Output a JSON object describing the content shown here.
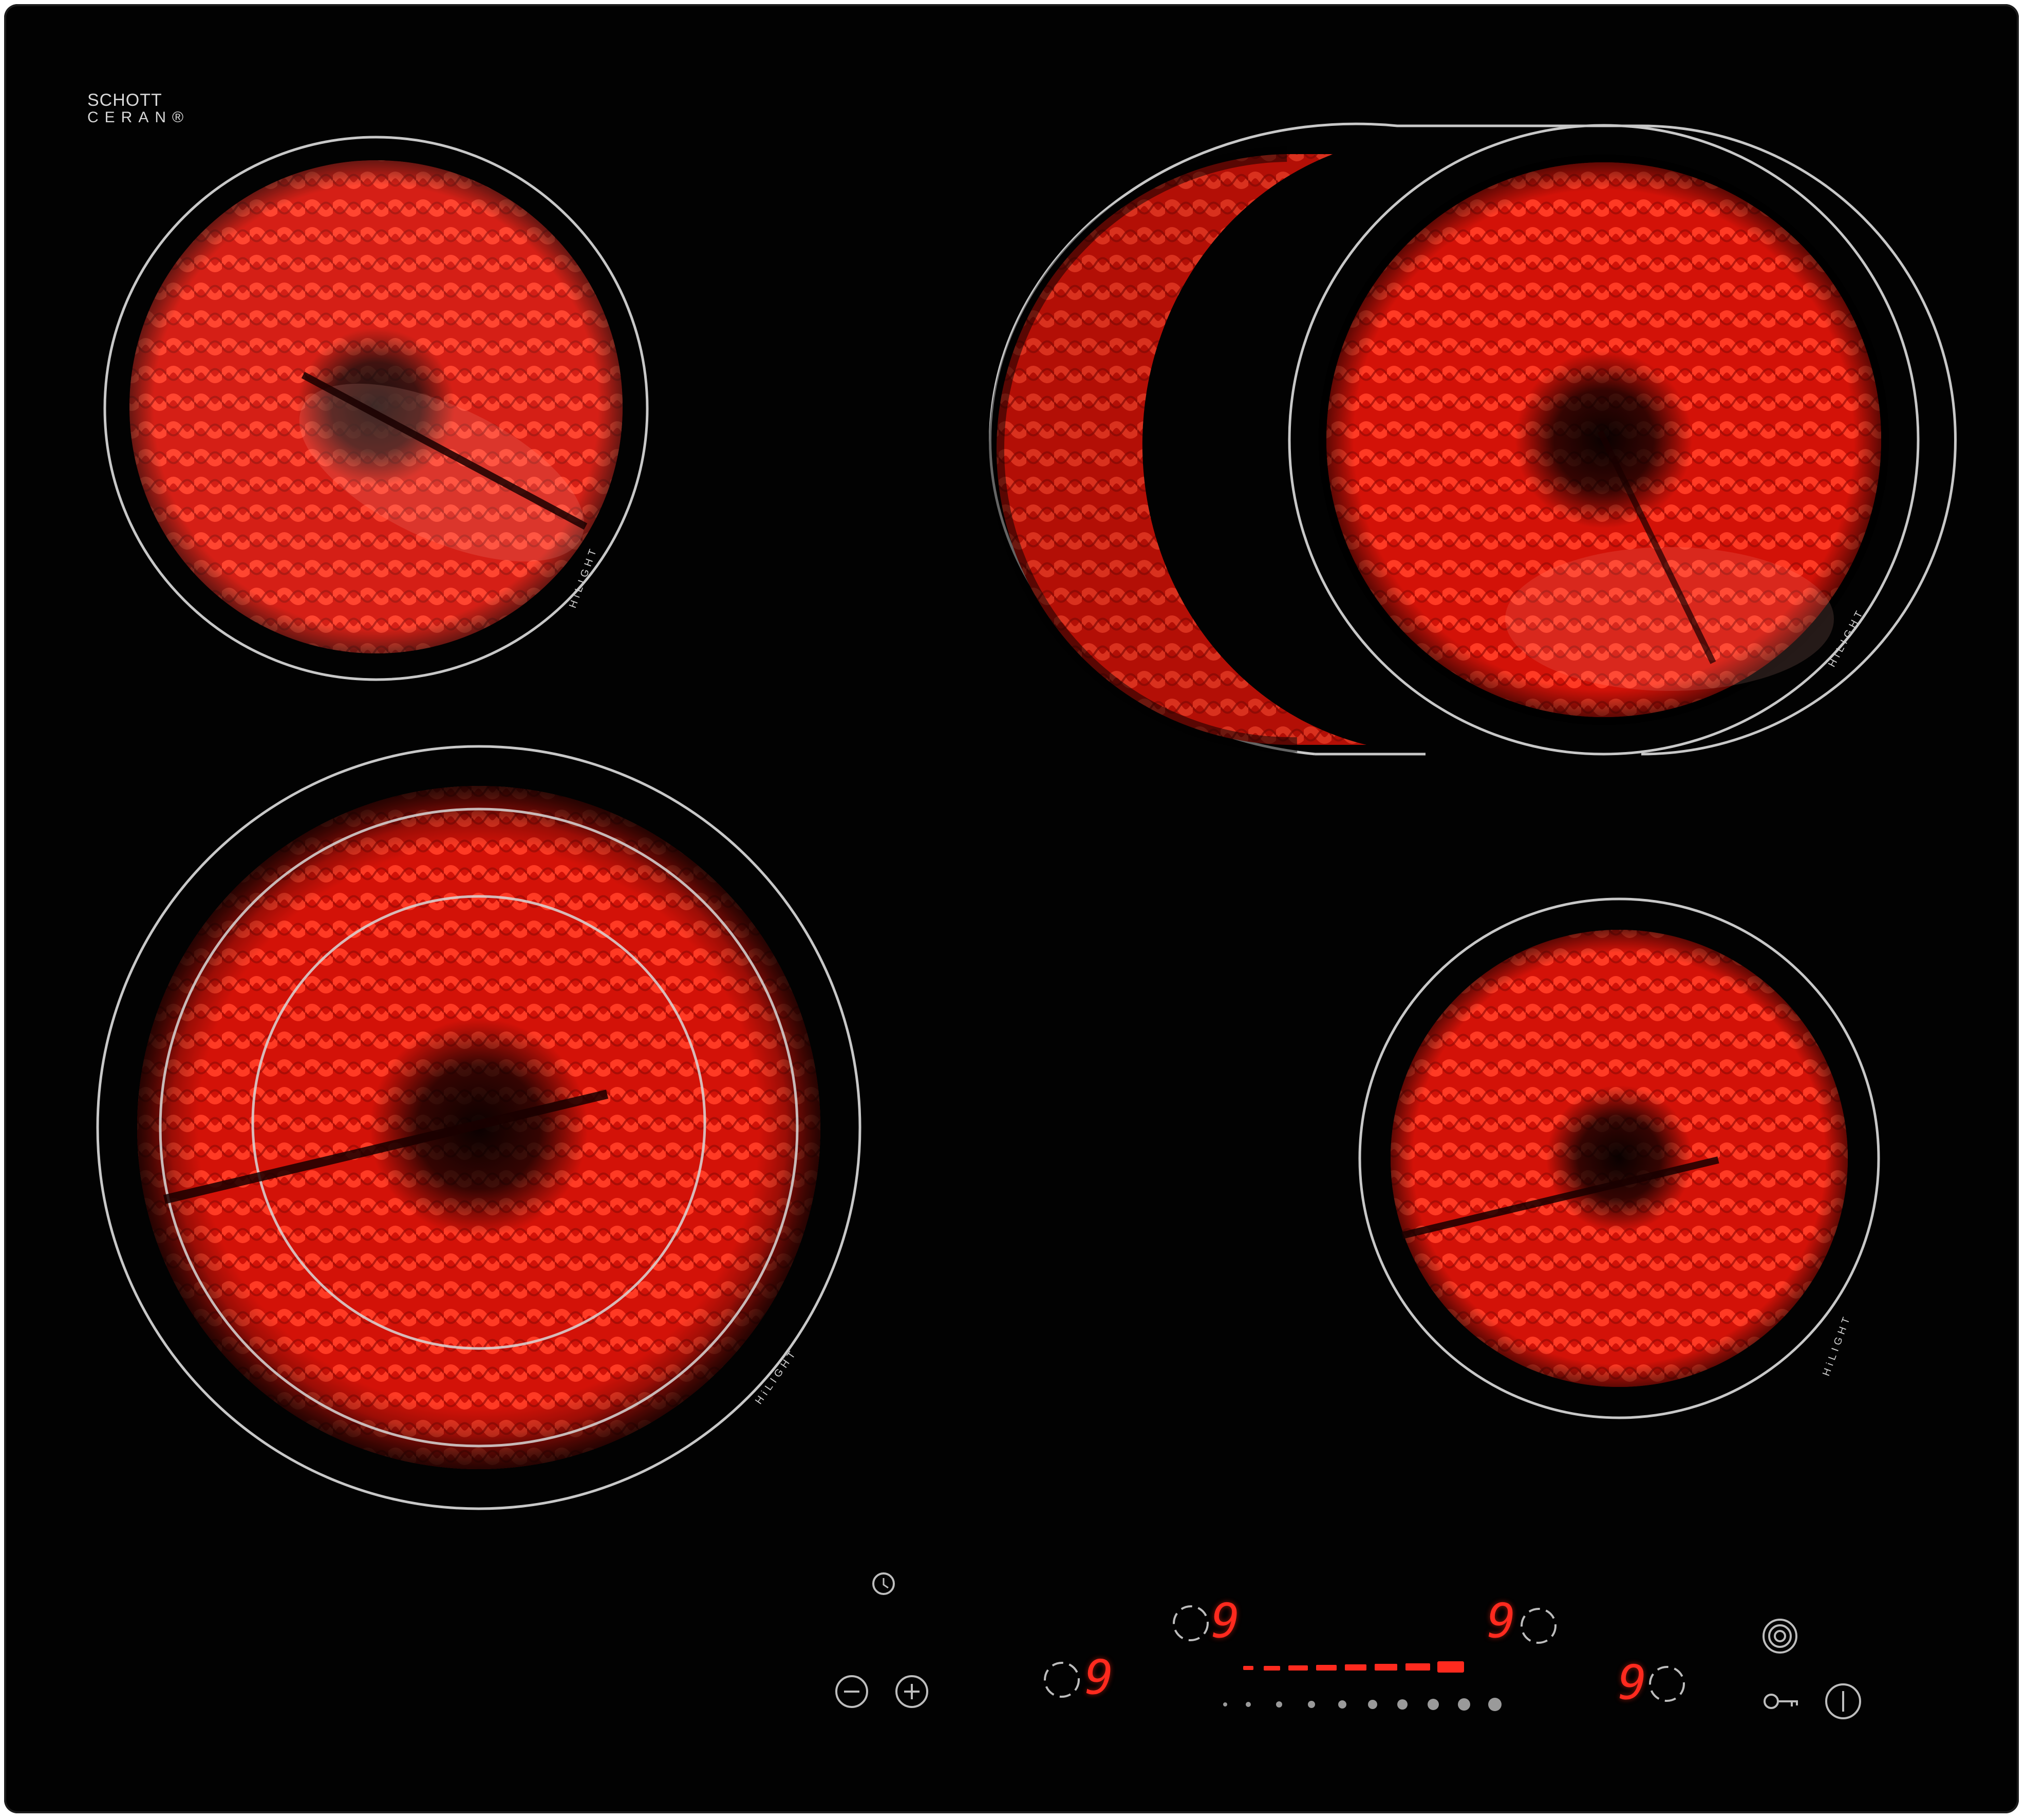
{
  "brand": {
    "line1": "SCHOTT",
    "line2": "CERAN®"
  },
  "zones": [
    {
      "id": "back-left",
      "glow": "#ff1a0a",
      "label": "HiLIGHT"
    },
    {
      "id": "back-right-bridge",
      "glow": "#ff1a0a",
      "label": "HiLIGHT"
    },
    {
      "id": "front-left-triple",
      "glow": "#ff1a0a",
      "label": "HiLIGHT"
    },
    {
      "id": "front-right",
      "glow": "#ff1a0a",
      "label": "HiLIGHT"
    }
  ],
  "controls": {
    "timer_icon": "clock-icon",
    "minus_icon": "minus-icon",
    "plus_icon": "plus-icon",
    "bridge_icon": "triple-ring-icon",
    "lock_icon": "key-icon",
    "power_icon": "power-icon",
    "displays": [
      {
        "zone": "front-left",
        "value": "9"
      },
      {
        "zone": "back-left",
        "value": "9"
      },
      {
        "zone": "back-right",
        "value": "9"
      },
      {
        "zone": "front-right",
        "value": "9"
      }
    ],
    "slider_level": 1.0
  },
  "colors": {
    "glass": "#020202",
    "glow": "#ff1a0a",
    "display": "#ff2a1e",
    "print": "#d0d0d0"
  }
}
